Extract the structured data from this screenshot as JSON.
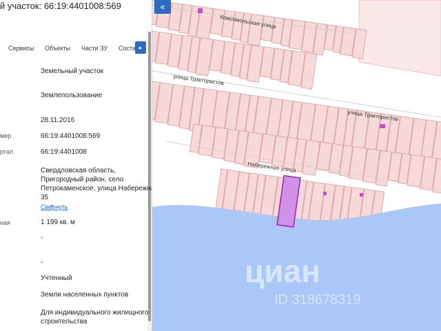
{
  "panel": {
    "title": "й участок: 66:19:4401008:569",
    "tabs": [
      "Сервисы",
      "Объекты",
      "Части ЗУ",
      "Соста"
    ],
    "next_icon": "chevron-right-icon",
    "rows": [
      {
        "label": "",
        "value": "Земельный участок"
      },
      {
        "label": "",
        "value": "Землепользование"
      },
      {
        "label": "",
        "value": "28.11.2016"
      },
      {
        "label": "мер",
        "value": "66:19:4401008:569"
      },
      {
        "label": "ртал",
        "value": "66:19:4401008"
      },
      {
        "label": "",
        "value_lines": [
          "Свердловская область,",
          "Пригородный район, село",
          "Петрокаменское, улица Набережная,",
          "35"
        ]
      },
      {
        "label": "ная",
        "value": "1 199 кв. м"
      },
      {
        "label": "",
        "value": "-"
      },
      {
        "label": "",
        "value": "-"
      },
      {
        "label": "",
        "value": "Учтенный"
      },
      {
        "label": "",
        "value": "Земли населенных пунктов"
      },
      {
        "label": "",
        "value_lines": [
          "Для индивидуального жилищного",
          "строительства"
        ]
      }
    ],
    "collapse_link": "Свернуть"
  },
  "map": {
    "collapse_icon": "double-chevron-left-icon",
    "streets": [
      "Комсомольская улица",
      "улица Трактористов",
      "улица Трактористов",
      "Набережная улица"
    ],
    "watermark_brand": "циан",
    "watermark_id": "ID 318678319",
    "colors": {
      "background": "#ffffff",
      "parcel_fill": "#f7d9d9",
      "parcel_stroke": "#d99a9a",
      "water": "#a9c8f7",
      "highlight_fill": "#cf92e6",
      "highlight_stroke": "#a21caf",
      "accent": "#2d6ac2"
    }
  }
}
